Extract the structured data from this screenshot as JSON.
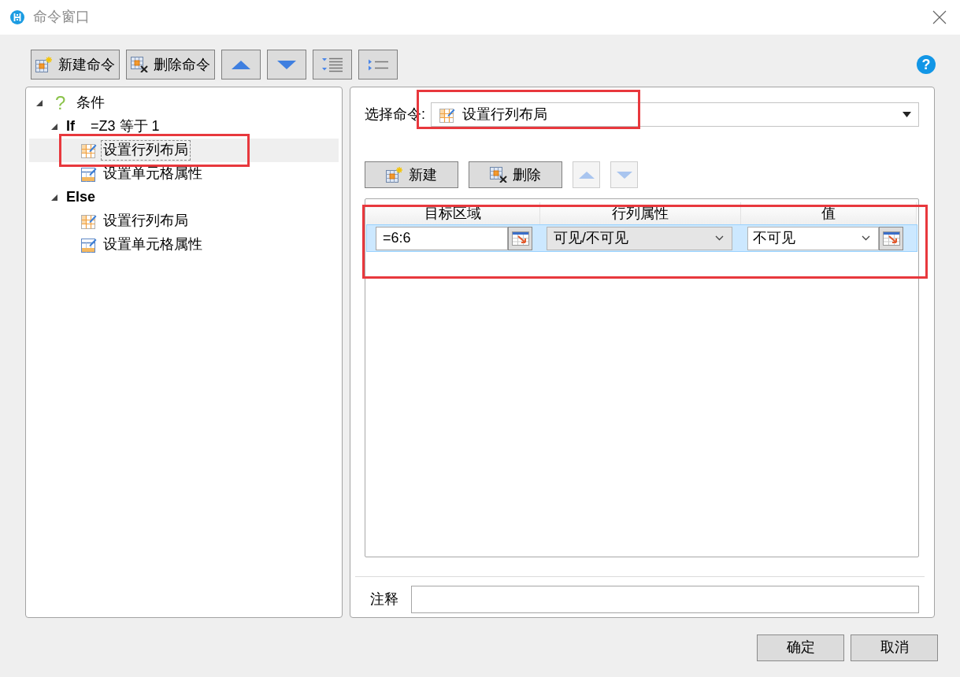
{
  "window": {
    "title": "命令窗口"
  },
  "toolbar": {
    "buttons": [
      {
        "kind": "new",
        "label": "新建命令",
        "disabled": false
      },
      {
        "kind": "delete",
        "label": "删除命令",
        "disabled": false
      },
      {
        "kind": "move-up",
        "disabled": false
      },
      {
        "kind": "move-down",
        "disabled": false
      },
      {
        "kind": "indent",
        "disabled": false
      },
      {
        "kind": "outdent",
        "disabled": false
      }
    ],
    "help": "?"
  },
  "tree": {
    "items": [
      {
        "kind": "condition",
        "icon": "?",
        "label": "条件",
        "expanded": true,
        "selected": false,
        "highlighted": false,
        "children": [
          {
            "kind": "branch",
            "label": "If",
            "expression": "=Z3 等于 1",
            "expanded": true,
            "selected": false,
            "highlighted": false,
            "children": [
              {
                "kind": "row-layout",
                "label": "设置行列布局",
                "selected": true,
                "highlighted": true
              },
              {
                "kind": "cell-props",
                "label": "设置单元格属性",
                "selected": false,
                "highlighted": false
              }
            ]
          },
          {
            "kind": "branch",
            "label": "Else",
            "expanded": true,
            "selected": false,
            "highlighted": false,
            "children": [
              {
                "kind": "row-layout",
                "label": "设置行列布局",
                "selected": false,
                "highlighted": false
              },
              {
                "kind": "cell-props",
                "label": "设置单元格属性",
                "selected": false,
                "highlighted": false
              }
            ]
          }
        ]
      }
    ]
  },
  "command": {
    "label": "选择命令:",
    "kind": "row-layout",
    "value": "设置行列布局",
    "highlighted": true
  },
  "detail_toolbar": {
    "buttons": [
      {
        "kind": "new",
        "label": "新建",
        "disabled": false
      },
      {
        "kind": "delete",
        "label": "删除",
        "disabled": false
      },
      {
        "kind": "move-up",
        "disabled": true
      },
      {
        "kind": "move-down",
        "disabled": true
      }
    ]
  },
  "grid": {
    "highlighted": true,
    "columns": [
      "目标区域",
      "行列属性",
      "值"
    ],
    "rows": [
      {
        "selected": true,
        "target_range": "=6:6",
        "property": "可见/不可见",
        "value": "不可见"
      }
    ]
  },
  "note": {
    "label": "注释"
  },
  "footer": {
    "buttons": [
      "确定",
      "取消"
    ]
  }
}
